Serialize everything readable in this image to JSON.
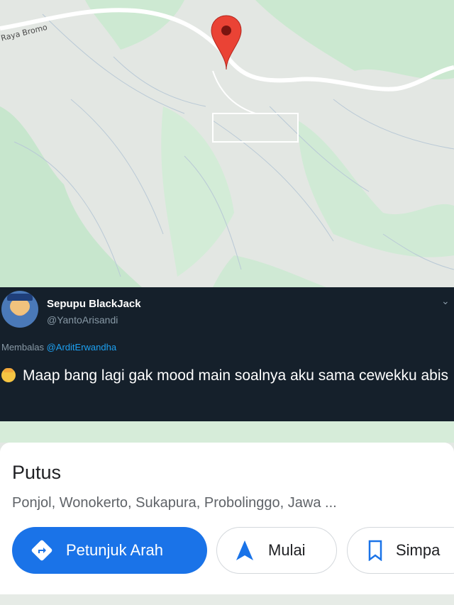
{
  "map": {
    "road_label": "Raya Bromo",
    "pin_color": "#ea4335",
    "green": "#c9e8cf",
    "gray": "#eceeec"
  },
  "tweet": {
    "author": "Sepupu BlackJack",
    "handle": "@YantoArisandi",
    "reply_prefix": "Membalas",
    "reply_to": "@ArditErwandha",
    "emoji_icon": "person-emoji-icon",
    "text": "Maap bang lagi gak mood main soalnya aku sama cewekku abis",
    "background": "#15202b",
    "link_color": "#1da1f2"
  },
  "place": {
    "title": "Putus",
    "address": "Ponjol, Wonokerto, Sukapura, Probolinggo, Jawa ..."
  },
  "actions": {
    "directions_label": "Petunjuk Arah",
    "start_label": "Mulai",
    "save_label": "Simpa",
    "primary_color": "#1a73e8"
  }
}
